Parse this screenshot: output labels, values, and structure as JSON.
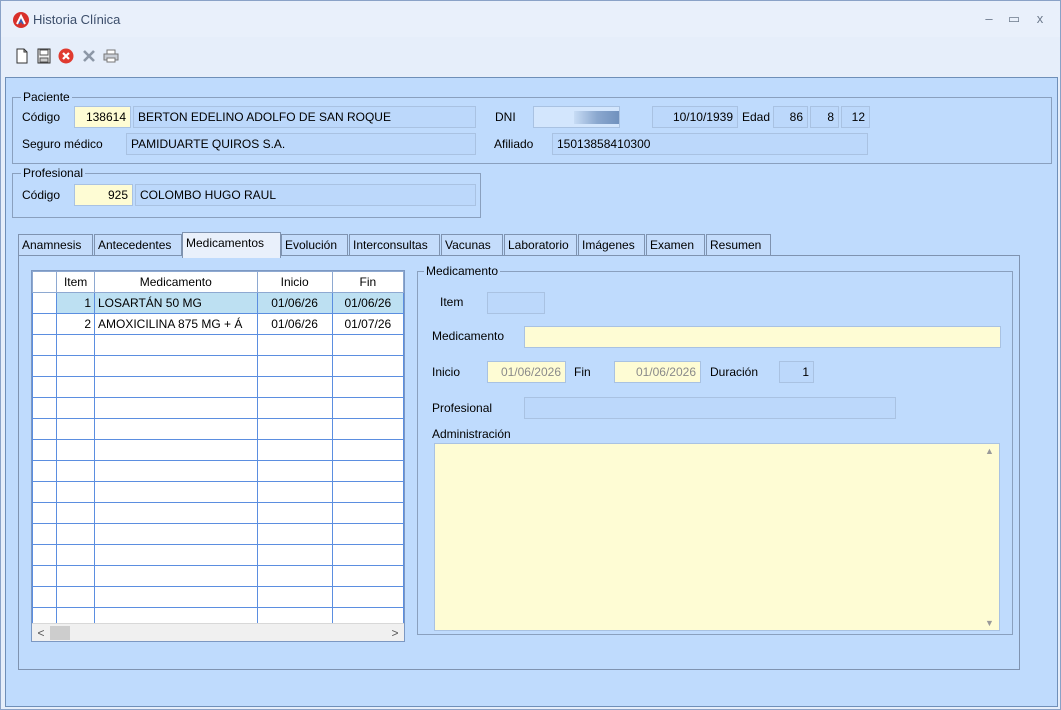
{
  "window": {
    "title": "Historia Clínica",
    "minimize": "–",
    "maximize": "▭",
    "close": "x"
  },
  "toolbar": {
    "new_icon": "new-document-icon",
    "save_icon": "save-icon",
    "cancel_icon": "cancel-icon",
    "delete_icon": "delete-icon",
    "print_icon": "print-icon"
  },
  "paciente": {
    "group": "Paciente",
    "codigo_label": "Código",
    "codigo": "138614",
    "nombre": "BERTON EDELINO ADOLFO DE SAN ROQUE",
    "dni_label": "DNI",
    "fecha_nac": "10/10/1939",
    "edad_label": "Edad",
    "edad_anios": "86",
    "edad_meses": "8",
    "edad_dias": "12",
    "seguro_label": "Seguro médico",
    "seguro": "PAMIDUARTE QUIROS S.A.",
    "afiliado_label": "Afiliado",
    "afiliado": "15013858410300"
  },
  "profesional": {
    "group": "Profesional",
    "codigo_label": "Código",
    "codigo": "925",
    "nombre": "COLOMBO HUGO RAUL"
  },
  "tabs": [
    "Anamnesis",
    "Antecedentes",
    "Medicamentos",
    "Evolución",
    "Interconsultas",
    "Vacunas",
    "Laboratorio",
    "Imágenes",
    "Examen",
    "Resumen"
  ],
  "grid": {
    "headers": [
      "Item",
      "Medicamento",
      "Inicio",
      "Fin"
    ],
    "rows": [
      [
        "1",
        "LOSARTÁN 50 MG",
        "01/06/26",
        "01/06/26"
      ],
      [
        "2",
        "AMOXICILINA 875 MG + Á",
        "01/06/26",
        "01/07/26"
      ]
    ]
  },
  "detalle": {
    "group": "Medicamento",
    "item_label": "Item",
    "item": "",
    "medicamento_label": "Medicamento",
    "medicamento": "",
    "inicio_label": "Inicio",
    "inicio": "01/06/2026",
    "fin_label": "Fin",
    "fin": "01/06/2026",
    "duracion_label": "Duración",
    "duracion": "1",
    "profesional_label": "Profesional",
    "profesional": "",
    "administracion_label": "Administración",
    "administracion": ""
  }
}
